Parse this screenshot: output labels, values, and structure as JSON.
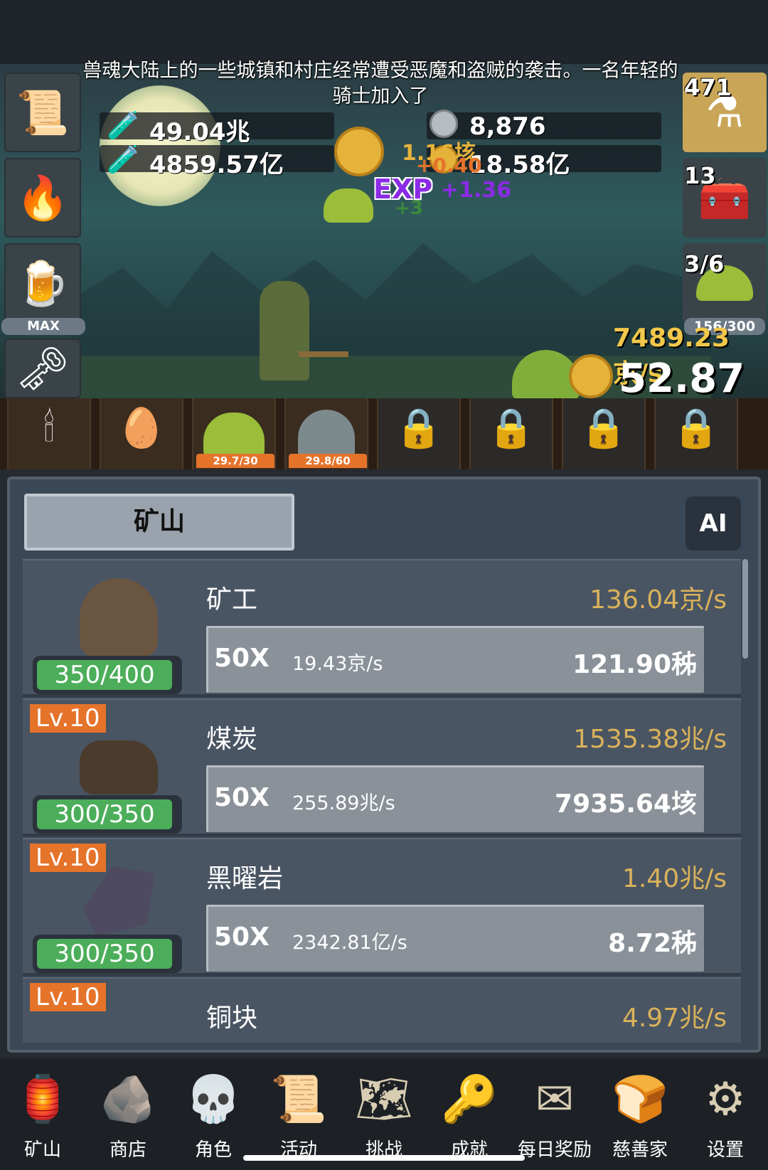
{
  "scene": {
    "story": "兽魂大陆上的一些城镇和村庄经常遭受恶魔和盗贼的袭击。一名年轻的骑士加入了",
    "resources": {
      "blue_potion": "49.04兆",
      "green_potion": "4859.57亿",
      "silver_coin": "8,876",
      "gold_coin": "18.58亿"
    },
    "floating": {
      "gain1": "1.16垓",
      "gain2": "+0.40",
      "exp_label": "EXP",
      "exp_value": "+1.36",
      "gain3": "+3"
    },
    "left_tools": [
      {
        "icon": "scroll-icon"
      },
      {
        "icon": "torch-icon"
      },
      {
        "icon": "beer-mug-icon",
        "badge": "MAX"
      },
      {
        "icon": "key-icon"
      }
    ],
    "right_items": [
      {
        "icon": "potion-icon",
        "count": "471"
      },
      {
        "icon": "chest-icon",
        "count": "13"
      },
      {
        "icon": "slime-icon",
        "count": "3/6",
        "hp": "156/300"
      }
    ],
    "dps": "7489.23京/s",
    "damage": "52.87垓"
  },
  "slots": [
    {
      "icon": "candle-icon",
      "locked": false
    },
    {
      "icon": "egg-icon",
      "locked": false
    },
    {
      "icon": "slime-icon",
      "locked": false,
      "count": "29.7/30"
    },
    {
      "icon": "ghost-icon",
      "locked": false,
      "count": "29.8/60"
    },
    {
      "icon": "lock-icon",
      "locked": true
    },
    {
      "icon": "lock-icon",
      "locked": true
    },
    {
      "icon": "lock-icon",
      "locked": true
    },
    {
      "icon": "lock-icon",
      "locked": true
    }
  ],
  "panel": {
    "tab_title": "矿山",
    "ai_label": "AI",
    "rows": [
      {
        "level": "",
        "name": "矿工",
        "rate": "136.04京/s",
        "capacity": "350/400",
        "multiplier": "50X",
        "buy_rate": "19.43京/s",
        "cost": "121.90秭",
        "icon": "miner-icon"
      },
      {
        "level": "Lv.10",
        "name": "煤炭",
        "rate": "1535.38兆/s",
        "capacity": "300/350",
        "multiplier": "50X",
        "buy_rate": "255.89兆/s",
        "cost": "7935.64垓",
        "icon": "coal-icon"
      },
      {
        "level": "Lv.10",
        "name": "黑曜岩",
        "rate": "1.40兆/s",
        "capacity": "300/350",
        "multiplier": "50X",
        "buy_rate": "2342.81亿/s",
        "cost": "8.72秭",
        "icon": "obsidian-icon"
      },
      {
        "level": "Lv.10",
        "name": "铜块",
        "rate": "4.97兆/s",
        "icon": "copper-icon"
      }
    ]
  },
  "nav": [
    {
      "label": "矿山",
      "icon": "lantern-icon"
    },
    {
      "label": "商店",
      "icon": "stone-icon"
    },
    {
      "label": "角色",
      "icon": "skull-icon"
    },
    {
      "label": "活动",
      "icon": "scroll-icon"
    },
    {
      "label": "挑战",
      "icon": "map-icon"
    },
    {
      "label": "成就",
      "icon": "key-icon"
    },
    {
      "label": "每日奖励",
      "icon": "envelope-icon"
    },
    {
      "label": "慈善家",
      "icon": "bread-icon"
    },
    {
      "label": "设置",
      "icon": "gear-icon"
    }
  ]
}
